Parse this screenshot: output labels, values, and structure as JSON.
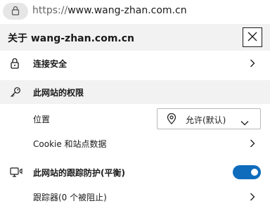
{
  "address": {
    "scheme": "https://",
    "host": "www.wang-zhan.com.cn"
  },
  "panel": {
    "title": "关于 wang-zhan.com.cn",
    "connection_label": "连接安全",
    "permissions_heading": "此网站的权限",
    "location_label": "位置",
    "location_value": "允许(默认)",
    "cookie_label": "Cookie 和站点数据",
    "tracking_label": "此网站的跟踪防护(平衡)",
    "tracking_enabled": true,
    "trackers_label": "跟踪器(0 个被阻止)"
  },
  "colors": {
    "toggle_on": "#0f6cbd",
    "header_bg": "#f2f2f2"
  },
  "icons": [
    "lock-icon",
    "close-icon",
    "key-icon",
    "location-pin-icon",
    "tracking-prevention-icon",
    "chevron-right-icon",
    "chevron-down-icon"
  ]
}
